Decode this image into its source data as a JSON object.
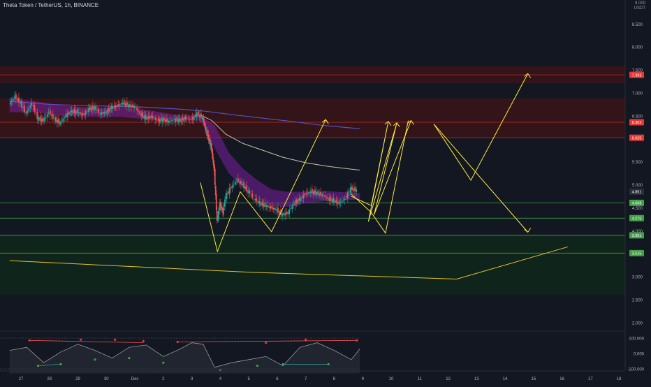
{
  "header": {
    "symbol": "Theta Token / TetherUS, 1h, BINANCE",
    "currency_top": "9.000",
    "currency_unit": "USDT"
  },
  "colors": {
    "background": "#131722",
    "candle_up": "#26a69a",
    "candle_down": "#ef5350",
    "hline_red": "#c62828",
    "hline_green": "#43a047",
    "drawing_yellow": "#ffeb3b",
    "ribbon_purple": "#7b1fa2",
    "ma_slow": "#5b4fc4",
    "ma_mid": "#c8c3a8",
    "trend_line": "#e6c229"
  },
  "chart_data": {
    "type": "candlestick",
    "title": "",
    "xlabel": "",
    "ylabel": "USDT",
    "ylim": [
      1.6,
      9.0
    ],
    "grid": false,
    "x_ticks": [
      "27",
      "28",
      "29",
      "30",
      "Dec",
      "2",
      "3",
      "4",
      "5",
      "6",
      "7",
      "8",
      "9",
      "10",
      "11",
      "12",
      "13",
      "14",
      "15",
      "16",
      "17",
      "18"
    ],
    "y_ticks": [
      "9.000",
      "8.500",
      "8.000",
      "7.500",
      "7.000",
      "6.500",
      "6.000",
      "5.500",
      "5.000",
      "4.500",
      "4.000",
      "3.500",
      "3.000",
      "2.500",
      "2.000"
    ],
    "price_labels": [
      {
        "text": "7.393",
        "value": 7.393,
        "color": "#e53935"
      },
      {
        "text": "6.362",
        "value": 6.362,
        "color": "#e53935"
      },
      {
        "text": "6.025",
        "value": 6.025,
        "color": "#e53935"
      },
      {
        "text": "4.851",
        "value": 4.851,
        "color": "#2a2e39"
      },
      {
        "text": "4.608",
        "value": 4.608,
        "color": "#43a047"
      },
      {
        "text": "4.275",
        "value": 4.275,
        "color": "#43a047"
      },
      {
        "text": "3.901",
        "value": 3.901,
        "color": "#43a047"
      },
      {
        "text": "3.515",
        "value": 3.515,
        "color": "#43a047"
      }
    ],
    "resistance_zones": [
      [
        7.21,
        7.58
      ],
      [
        6.02,
        6.88
      ]
    ],
    "support_zone": [
      2.6,
      3.92
    ],
    "ohlc_path": [
      [
        26.6,
        6.75
      ],
      [
        26.8,
        6.92
      ],
      [
        27.0,
        6.78
      ],
      [
        27.2,
        6.55
      ],
      [
        27.4,
        6.78
      ],
      [
        27.6,
        6.45
      ],
      [
        27.8,
        6.4
      ],
      [
        28.0,
        6.58
      ],
      [
        28.2,
        6.42
      ],
      [
        28.4,
        6.35
      ],
      [
        28.6,
        6.52
      ],
      [
        28.8,
        6.6
      ],
      [
        29.0,
        6.58
      ],
      [
        29.2,
        6.52
      ],
      [
        29.4,
        6.65
      ],
      [
        29.6,
        6.68
      ],
      [
        29.8,
        6.55
      ],
      [
        30.0,
        6.58
      ],
      [
        30.2,
        6.68
      ],
      [
        30.4,
        6.72
      ],
      [
        30.6,
        6.78
      ],
      [
        30.8,
        6.72
      ],
      [
        31.0,
        6.7
      ],
      [
        31.2,
        6.55
      ],
      [
        31.4,
        6.45
      ],
      [
        31.6,
        6.48
      ],
      [
        31.8,
        6.4
      ],
      [
        32.0,
        6.42
      ],
      [
        32.2,
        6.38
      ],
      [
        32.4,
        6.42
      ],
      [
        32.6,
        6.4
      ],
      [
        32.8,
        6.45
      ],
      [
        33.0,
        6.42
      ],
      [
        33.2,
        6.55
      ],
      [
        33.4,
        6.45
      ],
      [
        33.5,
        6.2
      ],
      [
        33.6,
        6.0
      ],
      [
        33.7,
        5.8
      ],
      [
        33.8,
        5.3
      ],
      [
        33.9,
        4.2
      ],
      [
        34.0,
        4.6
      ],
      [
        34.1,
        4.4
      ],
      [
        34.2,
        4.75
      ],
      [
        34.4,
        4.95
      ],
      [
        34.6,
        5.1
      ],
      [
        34.8,
        5.0
      ],
      [
        35.0,
        4.85
      ],
      [
        35.2,
        4.7
      ],
      [
        35.4,
        4.6
      ],
      [
        35.6,
        4.55
      ],
      [
        35.8,
        4.5
      ],
      [
        36.0,
        4.45
      ],
      [
        36.2,
        4.35
      ],
      [
        36.4,
        4.4
      ],
      [
        36.6,
        4.6
      ],
      [
        36.8,
        4.68
      ],
      [
        37.0,
        4.8
      ],
      [
        37.2,
        4.85
      ],
      [
        37.4,
        4.82
      ],
      [
        37.6,
        4.78
      ],
      [
        37.8,
        4.7
      ],
      [
        38.0,
        4.65
      ],
      [
        38.2,
        4.6
      ],
      [
        38.4,
        4.7
      ],
      [
        38.6,
        4.92
      ],
      [
        38.8,
        4.88
      ]
    ],
    "ribbon": {
      "x": [
        26.6,
        27.5,
        28.5,
        29.5,
        30.5,
        31.5,
        32.5,
        33.3,
        33.8,
        34.3,
        34.8,
        35.3,
        35.8,
        36.3,
        36.8,
        37.3,
        37.8,
        38.3,
        38.9
      ],
      "upper": [
        6.88,
        6.82,
        6.72,
        6.68,
        6.68,
        6.62,
        6.52,
        6.5,
        6.3,
        5.7,
        5.35,
        5.1,
        4.9,
        4.85,
        4.85,
        4.86,
        4.86,
        4.84,
        4.82
      ],
      "lower": [
        6.58,
        6.58,
        6.5,
        6.48,
        6.48,
        6.42,
        6.4,
        6.4,
        5.8,
        5.25,
        4.95,
        4.7,
        4.55,
        4.52,
        4.58,
        4.62,
        4.65,
        4.66,
        4.68
      ]
    },
    "ma_slow": {
      "x": [
        26.6,
        28.0,
        29.5,
        31.0,
        32.5,
        33.5,
        34.5,
        35.5,
        36.5,
        37.5,
        38.9
      ],
      "values": [
        6.82,
        6.75,
        6.72,
        6.7,
        6.65,
        6.6,
        6.52,
        6.45,
        6.38,
        6.3,
        6.22
      ]
    },
    "ma_mid": {
      "x": [
        33.3,
        33.7,
        34.2,
        34.8,
        35.5,
        36.2,
        37.0,
        37.8,
        38.9
      ],
      "values": [
        6.52,
        6.4,
        6.1,
        5.9,
        5.75,
        5.6,
        5.48,
        5.4,
        5.32
      ]
    },
    "drawn_paths": [
      [
        [
          33.3,
          5.05
        ],
        [
          33.9,
          3.55
        ],
        [
          34.7,
          4.85
        ],
        [
          35.8,
          3.98
        ],
        [
          37.7,
          6.42
        ]
      ],
      [
        [
          38.6,
          4.75
        ],
        [
          39.3,
          4.55
        ],
        [
          39.9,
          6.38
        ],
        [
          39.2,
          4.2
        ],
        [
          40.2,
          6.35
        ],
        [
          39.4,
          4.35
        ],
        [
          40.7,
          6.4
        ]
      ],
      [
        [
          38.6,
          4.8
        ],
        [
          39.3,
          4.4
        ],
        [
          39.8,
          3.95
        ],
        [
          40.6,
          6.4
        ]
      ],
      [
        [
          41.5,
          6.32
        ],
        [
          42.8,
          5.1
        ],
        [
          44.8,
          7.42
        ]
      ],
      [
        [
          41.5,
          6.32
        ],
        [
          44.8,
          3.97
        ]
      ],
      [
        [
          26.6,
          3.35
        ],
        [
          35.0,
          3.1
        ],
        [
          42.3,
          2.95
        ],
        [
          46.2,
          3.65
        ]
      ]
    ],
    "arrow_tips": [
      [
        37.7,
        6.42
      ],
      [
        39.9,
        6.38
      ],
      [
        40.2,
        6.35
      ],
      [
        40.7,
        6.4
      ],
      [
        44.8,
        7.42
      ],
      [
        44.8,
        3.97
      ]
    ],
    "oscillator": {
      "y_ticks": [
        "100.000",
        "0.000",
        "-100.000"
      ],
      "ylim": [
        -130,
        130
      ],
      "line": {
        "x": [
          26.6,
          27.2,
          27.8,
          28.4,
          29.0,
          29.6,
          30.2,
          30.8,
          31.4,
          32.0,
          32.6,
          33.0,
          33.4,
          33.8,
          34.4,
          35.0,
          35.6,
          36.2,
          36.8,
          37.4,
          38.0,
          38.6,
          38.9
        ],
        "values": [
          20,
          40,
          -60,
          10,
          60,
          20,
          -30,
          40,
          55,
          -20,
          30,
          70,
          60,
          -90,
          -60,
          -40,
          -20,
          -80,
          40,
          70,
          20,
          -40,
          30
        ]
      },
      "dots_red": [
        [
          27.3,
          85
        ],
        [
          29.1,
          90
        ],
        [
          30.3,
          90
        ],
        [
          31.3,
          80
        ],
        [
          32.5,
          75
        ],
        [
          35.6,
          70
        ],
        [
          37.0,
          90
        ],
        [
          38.8,
          85
        ]
      ],
      "dots_green": [
        [
          27.6,
          -80
        ],
        [
          28.4,
          -70
        ],
        [
          29.6,
          -40
        ],
        [
          30.8,
          -30
        ],
        [
          32.0,
          -60
        ],
        [
          34.0,
          -110
        ],
        [
          35.3,
          -80
        ],
        [
          36.2,
          -70
        ],
        [
          37.8,
          -70
        ]
      ]
    }
  }
}
